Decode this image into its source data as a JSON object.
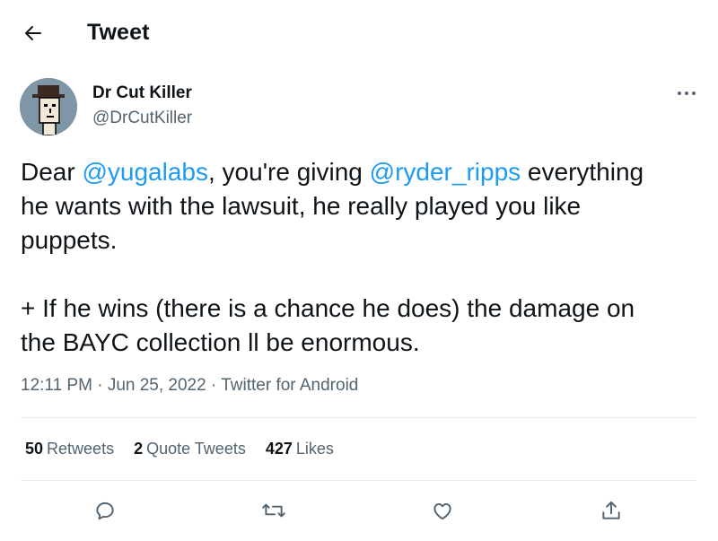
{
  "header": {
    "title": "Tweet",
    "back_icon": "arrow-left-icon"
  },
  "author": {
    "display_name": "Dr Cut Killer",
    "handle": "@DrCutKiller"
  },
  "tweet": {
    "segments": [
      {
        "text": "Dear ",
        "mention": false
      },
      {
        "text": "@yugalabs",
        "mention": true
      },
      {
        "text": ", you're giving ",
        "mention": false
      },
      {
        "text": "@ryder_ripps",
        "mention": true
      },
      {
        "text": " everything\nhe wants with the lawsuit, he really played you like\npuppets.\n\n+ If he wins (there is a chance he does) the damage on\nthe BAYC collection ll be enormous.",
        "mention": false
      }
    ],
    "time": "12:11 PM",
    "date": "Jun 25, 2022",
    "source": "Twitter for Android",
    "separator": "·"
  },
  "stats": {
    "retweets": {
      "count": "50",
      "label": "Retweets"
    },
    "quote_tweets": {
      "count": "2",
      "label": "Quote Tweets"
    },
    "likes": {
      "count": "427",
      "label": "Likes"
    }
  },
  "colors": {
    "mention": "#1d9bf0",
    "secondary_text": "#536471",
    "divider": "#e6ecf0"
  }
}
